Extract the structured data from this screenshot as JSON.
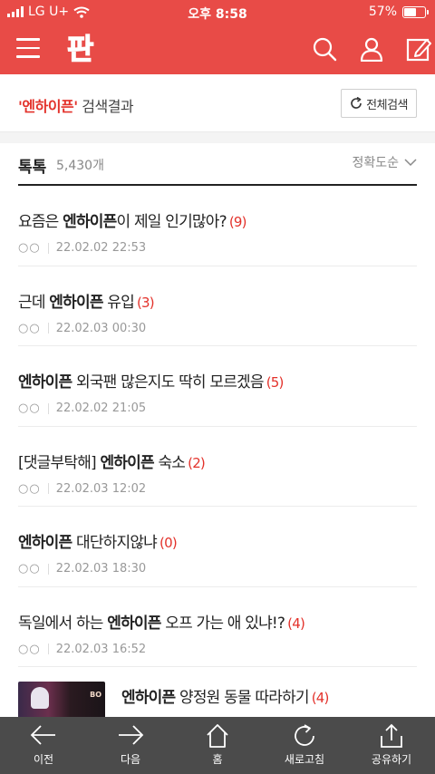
{
  "status": {
    "carrier": "LG U+",
    "time": "오후 8:58",
    "battery": "57%",
    "battery_level": 0.57
  },
  "header": {
    "logo_text": "판"
  },
  "search": {
    "keyword": "'엔하이픈'",
    "suffix": " 검색결과",
    "all_search_label": "전체검색"
  },
  "section": {
    "title": "톡톡",
    "count": "5,430개",
    "sort_label": "정확도순"
  },
  "items": [
    {
      "pre": "요즘은 ",
      "kw": "엔하이픈",
      "post": "이 제일 인기많아?",
      "comments": "(9)",
      "author": "○○",
      "date": "22.02.02 22:53"
    },
    {
      "pre": "근데 ",
      "kw": "엔하이픈",
      "post": " 유입",
      "comments": "(3)",
      "author": "○○",
      "date": "22.02.03 00:30"
    },
    {
      "pre": "",
      "kw": "엔하이픈",
      "post": " 외국팬 많은지도 딱히 모르겠음",
      "comments": "(5)",
      "author": "○○",
      "date": "22.02.02 21:05"
    },
    {
      "pre": "[댓글부탁해] ",
      "kw": "엔하이픈",
      "post": " 숙소",
      "comments": "(2)",
      "author": "○○",
      "date": "22.02.03 12:02"
    },
    {
      "pre": "",
      "kw": "엔하이픈",
      "post": " 대단하지않냐",
      "comments": "(0)",
      "author": "○○",
      "date": "22.02.03 18:30"
    },
    {
      "pre": "독일에서 하는 ",
      "kw": "엔하이픈",
      "post": " 오프 가는 애 있냐!?",
      "comments": "(4)",
      "author": "○○",
      "date": "22.02.03 16:52"
    },
    {
      "pre": "",
      "kw": "엔하이픈",
      "post": " 양정원 동물 따라하기",
      "comments": "(4)",
      "author": "",
      "date": "",
      "thumb_text": "BO"
    }
  ],
  "bottom_nav": [
    {
      "label": "이전",
      "icon": "arrow-left-icon"
    },
    {
      "label": "다음",
      "icon": "arrow-right-icon"
    },
    {
      "label": "홈",
      "icon": "home-icon"
    },
    {
      "label": "새로고침",
      "icon": "refresh-icon"
    },
    {
      "label": "공유하기",
      "icon": "share-icon"
    }
  ],
  "colors": {
    "brand": "#e84b47",
    "keyword": "#e3322b",
    "bottom_bar": "#4b4b4b"
  }
}
